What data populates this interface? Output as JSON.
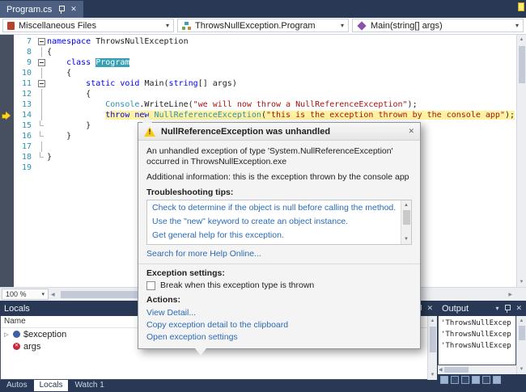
{
  "window": {
    "tab_title": "Program.cs"
  },
  "navbar": {
    "project": "Miscellaneous Files",
    "type": "ThrowsNullException.Program",
    "member": "Main(string[] args)"
  },
  "icons": {
    "close": "✕",
    "chevron_down": "▾",
    "up_arrow": "▲",
    "down_arrow": "▼",
    "left_arrow": "◀",
    "right_arrow": "▶",
    "expander": "▷"
  },
  "colors": {
    "chrome": "#293955",
    "keyword": "#0000ee",
    "type_name": "#2b91af",
    "string_literal": "#a31515",
    "exec_highlight": "#fff3a2",
    "link": "#2b6bb2",
    "warning_yellow": "#fcc716",
    "tab_active": "#4d6082"
  },
  "editor": {
    "zoom": "100 %",
    "lines": [
      {
        "num": "7",
        "fold": "box",
        "tokens": [
          [
            "kw",
            "namespace"
          ],
          [
            "pl",
            " ThrowsNullException"
          ]
        ]
      },
      {
        "num": "8",
        "fold": "line",
        "tokens": [
          [
            "pl",
            "{"
          ]
        ]
      },
      {
        "num": "9",
        "fold": "box",
        "tokens": [
          [
            "pl",
            "    "
          ],
          [
            "kw",
            "class"
          ],
          [
            "pl",
            " "
          ],
          [
            "sel",
            "Program"
          ]
        ]
      },
      {
        "num": "10",
        "fold": "line",
        "tokens": [
          [
            "pl",
            "    {"
          ]
        ]
      },
      {
        "num": "11",
        "fold": "box",
        "tokens": [
          [
            "pl",
            "        "
          ],
          [
            "kw",
            "static"
          ],
          [
            "pl",
            " "
          ],
          [
            "kw",
            "void"
          ],
          [
            "pl",
            " Main("
          ],
          [
            "kw",
            "string"
          ],
          [
            "pl",
            "[] args)"
          ]
        ]
      },
      {
        "num": "12",
        "fold": "line",
        "tokens": [
          [
            "pl",
            "        {"
          ]
        ]
      },
      {
        "num": "13",
        "fold": "line",
        "tokens": [
          [
            "pl",
            "            "
          ],
          [
            "ty",
            "Console"
          ],
          [
            "pl",
            ".WriteLine("
          ],
          [
            "st",
            "\"we will now throw a NullReferenceException\""
          ],
          [
            "pl",
            ");"
          ]
        ]
      },
      {
        "num": "14",
        "fold": "line",
        "exec": true,
        "tokens": [
          [
            "pl",
            "            "
          ],
          [
            "kw",
            "throw",
            1
          ],
          [
            "pl",
            " ",
            1
          ],
          [
            "kw",
            "new",
            1
          ],
          [
            "pl",
            " ",
            1
          ],
          [
            "ty",
            "NullReferenceException",
            1
          ],
          [
            "pl",
            "(",
            1
          ],
          [
            "st",
            "\"this is the exception thrown by the console app\"",
            1
          ],
          [
            "pl",
            ");",
            1
          ]
        ]
      },
      {
        "num": "15",
        "fold": "end",
        "tokens": [
          [
            "pl",
            "        }"
          ]
        ]
      },
      {
        "num": "16",
        "fold": "end",
        "tokens": [
          [
            "pl",
            "    }"
          ]
        ]
      },
      {
        "num": "17",
        "fold": "line",
        "tokens": []
      },
      {
        "num": "18",
        "fold": "end",
        "tokens": [
          [
            "pl",
            "}"
          ]
        ]
      },
      {
        "num": "19",
        "fold": "",
        "tokens": []
      }
    ]
  },
  "dialog": {
    "title": "NullReferenceException was unhandled",
    "message": "An unhandled exception of type 'System.NullReferenceException' occurred in ThrowsNullException.exe",
    "additional": "Additional information: this is the exception thrown by the console app",
    "tips_label": "Troubleshooting tips:",
    "tips": [
      "Check to determine if the object is null before calling the method.",
      "Use the \"new\" keyword to create an object instance.",
      "Get general help for this exception."
    ],
    "search_link": "Search for more Help Online...",
    "settings_label": "Exception settings:",
    "checkbox_label": "Break when this exception type is thrown",
    "actions_label": "Actions:",
    "actions": [
      "View Detail...",
      "Copy exception detail to the clipboard",
      "Open exception settings"
    ]
  },
  "locals": {
    "title": "Locals",
    "columns": [
      "Name"
    ],
    "rows": [
      {
        "name": "$exception",
        "icon": "exception",
        "expandable": true
      },
      {
        "name": "args",
        "icon": "null-error",
        "expandable": false
      }
    ],
    "tabs": [
      "Autos",
      "Locals",
      "Watch 1"
    ],
    "active_tab": "Locals"
  },
  "output": {
    "title": "Output",
    "lines": [
      "'ThrowsNullExcep",
      "'ThrowsNullExcep",
      "'ThrowsNullExcep"
    ]
  }
}
